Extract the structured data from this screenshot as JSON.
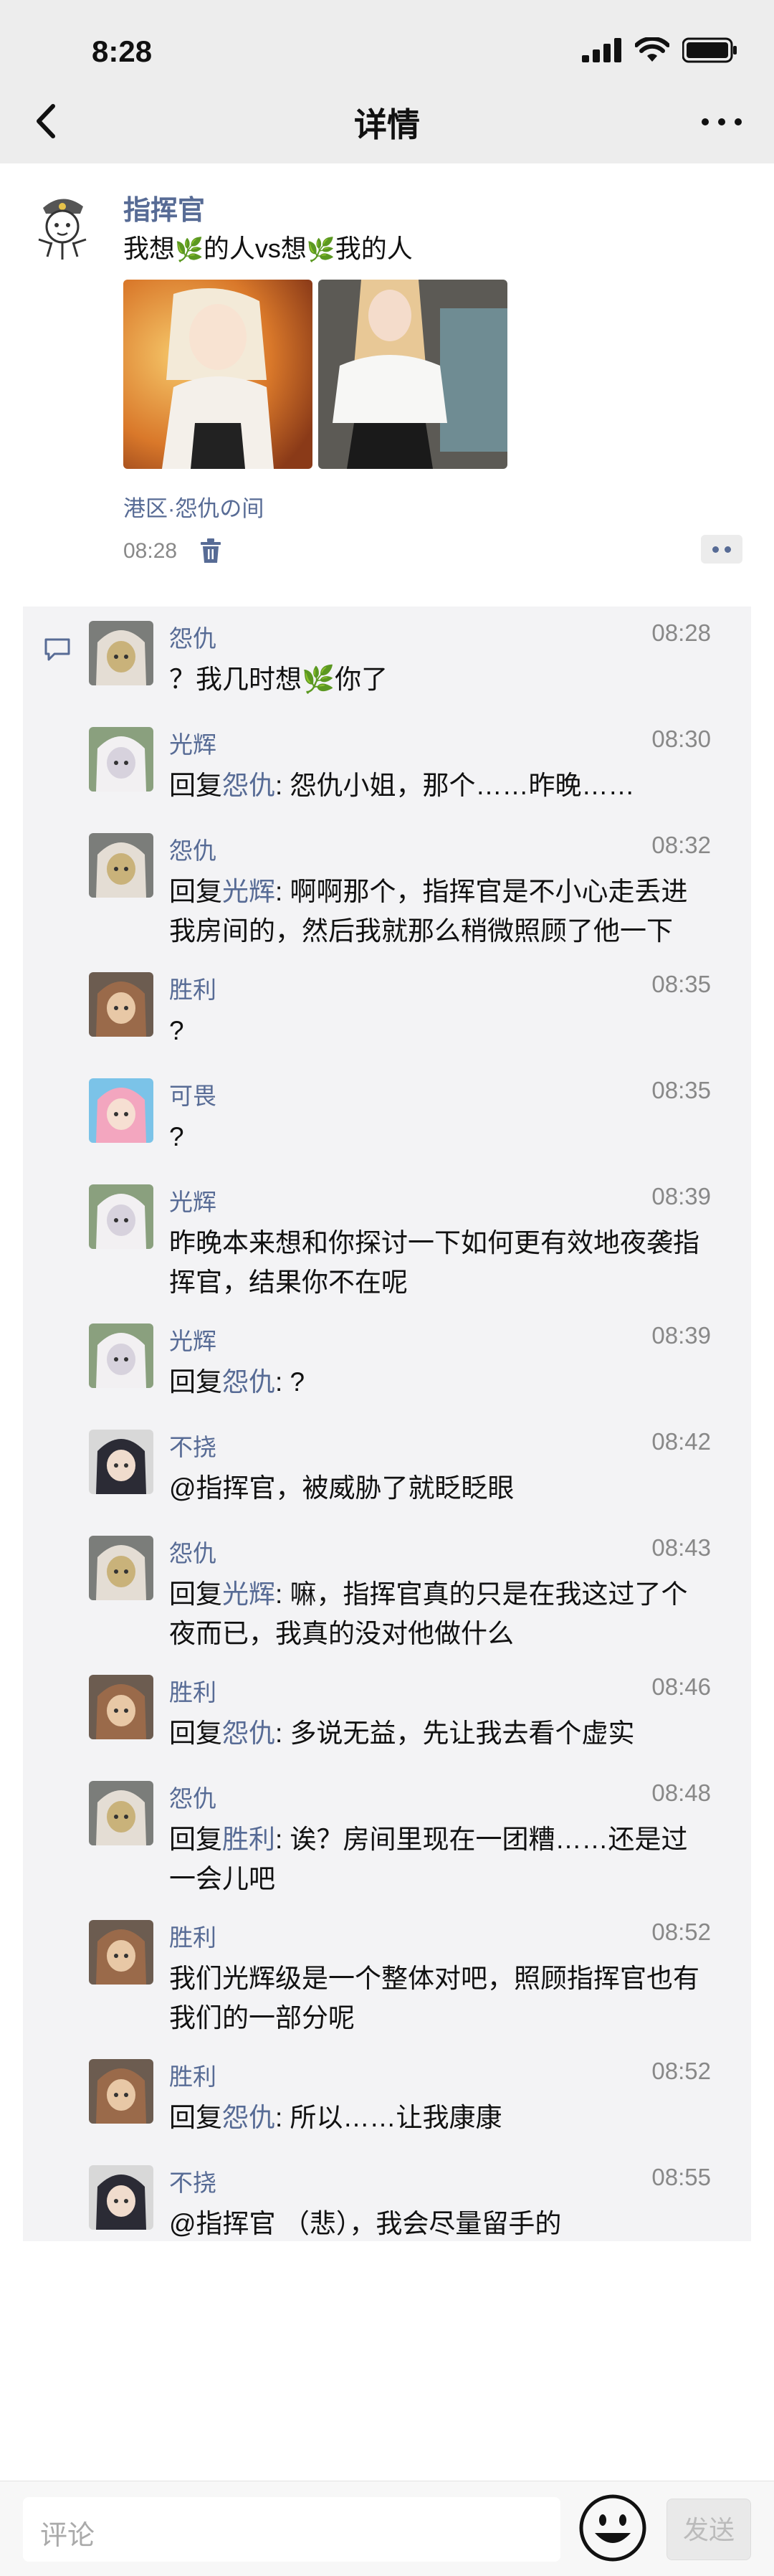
{
  "status_bar": {
    "time": "8:28"
  },
  "nav": {
    "title": "详情"
  },
  "post": {
    "author": "指挥官",
    "text_parts": [
      "我想",
      "的人vs想",
      "我的人"
    ],
    "location": "港区·怨仇の间",
    "time": "08:28"
  },
  "comments": [
    {
      "name": "怨仇",
      "time": "08:28",
      "text": "？我几时想🌿你了",
      "avatar": "grey-haired"
    },
    {
      "name": "光辉",
      "time": "08:30",
      "reply_to": "怨仇",
      "text": ": 怨仇小姐，那个……昨晚……",
      "avatar": "white-haired"
    },
    {
      "name": "怨仇",
      "time": "08:32",
      "reply_to": "光辉",
      "text": ": 啊啊那个，指挥官是不小心走丢进我房间的，然后我就那么稍微照顾了他一下",
      "avatar": "grey-haired"
    },
    {
      "name": "胜利",
      "time": "08:35",
      "text": "?",
      "avatar": "brown-haired"
    },
    {
      "name": "可畏",
      "time": "08:35",
      "text": "?",
      "avatar": "pink-haired"
    },
    {
      "name": "光辉",
      "time": "08:39",
      "text": "昨晚本来想和你探讨一下如何更有效地夜袭指挥官，结果你不在呢",
      "avatar": "white-haired"
    },
    {
      "name": "光辉",
      "time": "08:39",
      "reply_to": "怨仇",
      "text": ": ?",
      "avatar": "white-haired"
    },
    {
      "name": "不挠",
      "time": "08:42",
      "text": "@指挥官，被威胁了就眨眨眼",
      "avatar": "dark-haired"
    },
    {
      "name": "怨仇",
      "time": "08:43",
      "reply_to": "光辉",
      "text": ": 嘛，指挥官真的只是在我这过了个夜而已，我真的没对他做什么",
      "avatar": "grey-haired"
    },
    {
      "name": "胜利",
      "time": "08:46",
      "reply_to": "怨仇",
      "text": ": 多说无益，先让我去看个虚实",
      "avatar": "brown-haired"
    },
    {
      "name": "怨仇",
      "time": "08:48",
      "reply_to": "胜利",
      "text": ": 诶？房间里现在一团糟……还是过一会儿吧",
      "avatar": "grey-haired"
    },
    {
      "name": "胜利",
      "time": "08:52",
      "text": "我们光辉级是一个整体对吧，照顾指挥官也有我们的一部分呢",
      "avatar": "brown-haired"
    },
    {
      "name": "胜利",
      "time": "08:52",
      "reply_to": "怨仇",
      "text": ": 所以……让我康康",
      "avatar": "brown-haired"
    },
    {
      "name": "不挠",
      "time": "08:55",
      "text": "@指挥官 （悲），我会尽量留手的",
      "avatar": "dark-haired"
    }
  ],
  "reply_prefix": "回复",
  "input": {
    "placeholder": "评论",
    "send_label": "发送"
  },
  "colors": {
    "link": "#576b95",
    "bg": "#ededed",
    "comment_bg": "#f3f3f5"
  }
}
